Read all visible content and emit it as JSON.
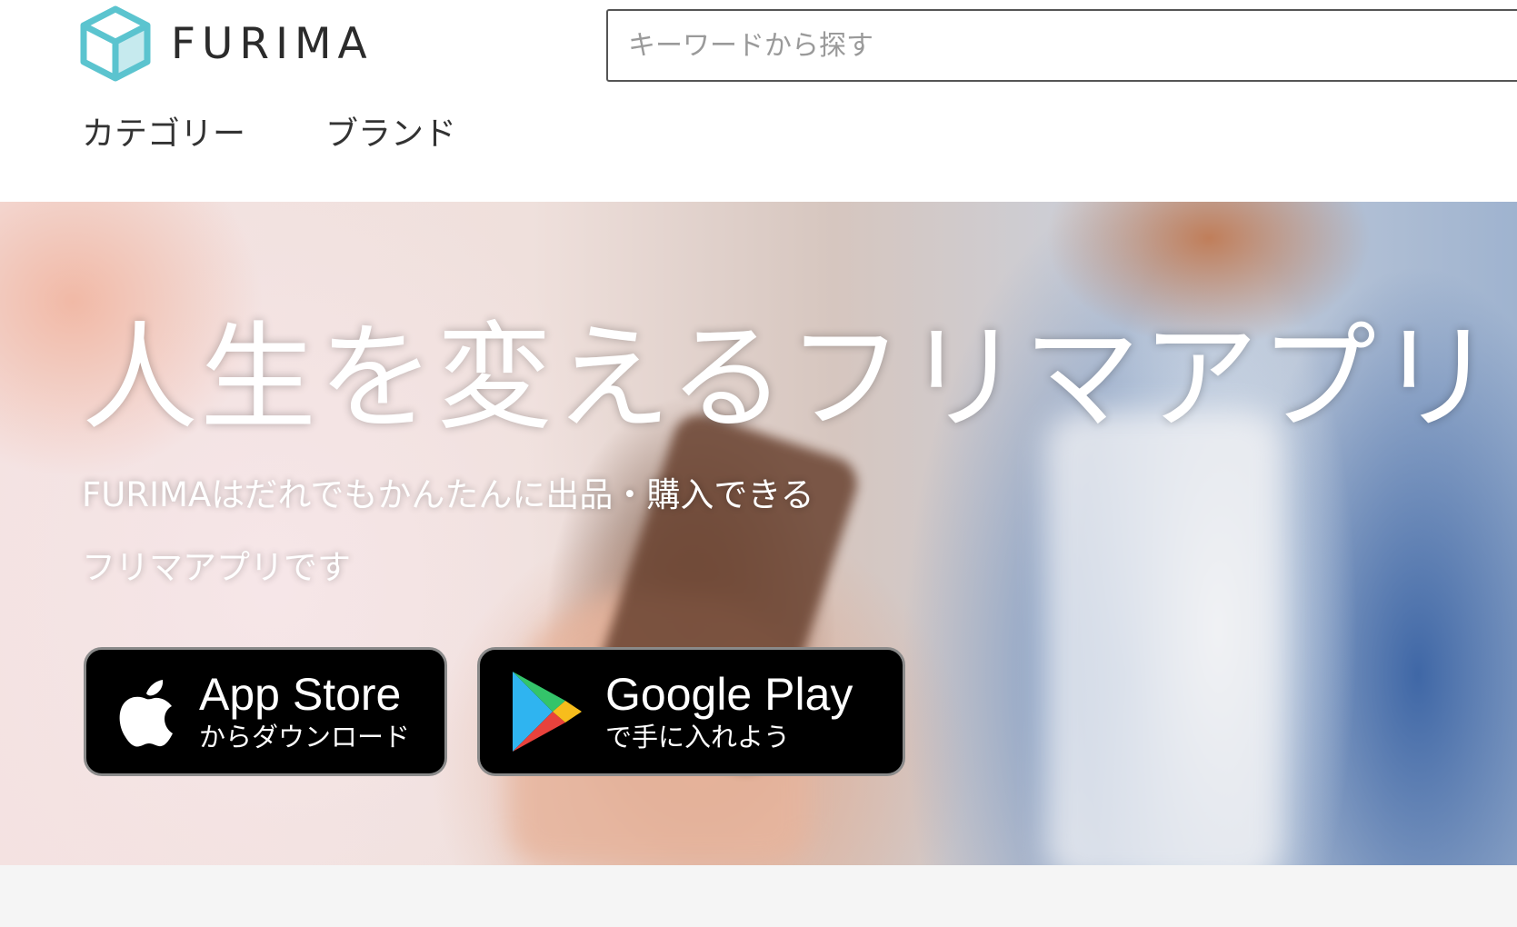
{
  "header": {
    "logo_text": "FURIMA",
    "logo_icon": "box-icon",
    "search_placeholder": "キーワードから探す",
    "nav": [
      "カテゴリー",
      "ブランド"
    ]
  },
  "hero": {
    "title": "人生を変えるフリマアプリ",
    "subtitle_line1": "FURIMAはだれでもかんたんに出品・購入できる",
    "subtitle_line2": "フリマアプリです",
    "app_store": {
      "icon": "apple-icon",
      "main": "App Store",
      "small": "からダウンロード"
    },
    "google_play": {
      "icon": "google-play-icon",
      "main": "Google Play",
      "small": "で手に入れよう"
    }
  },
  "colors": {
    "logo_accent": "#5bc4cf",
    "button_bg": "#000000",
    "hero_text": "#ffffff"
  }
}
